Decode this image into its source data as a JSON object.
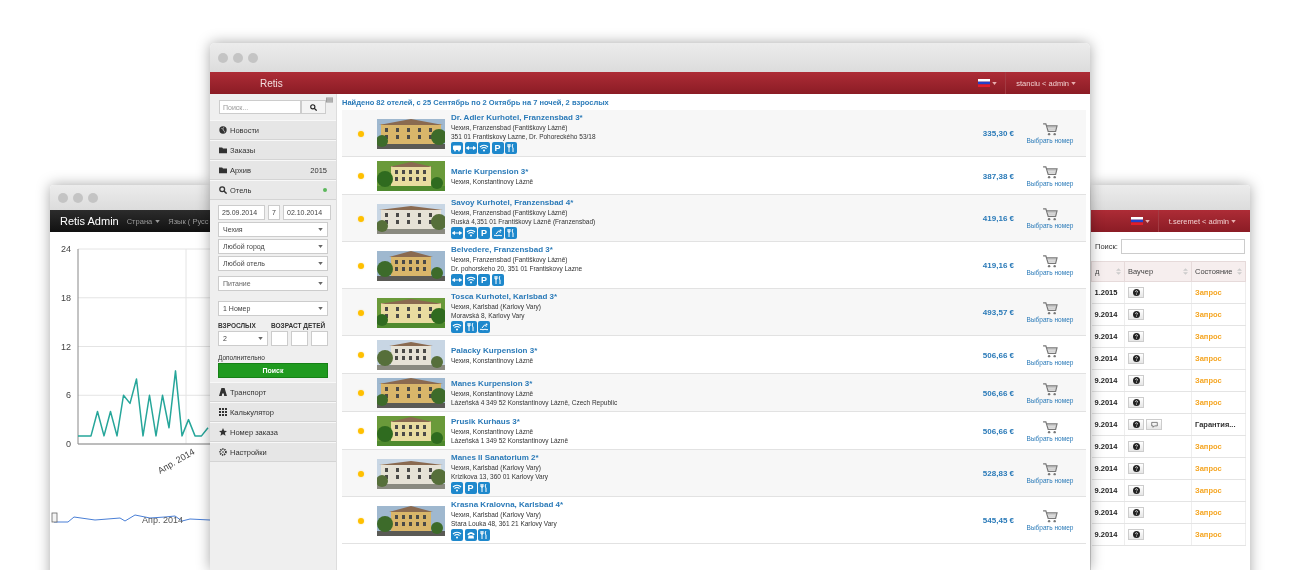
{
  "stats_window": {
    "brand": "Retis Admin",
    "menu": [
      {
        "label": "Страна",
        "dropdown": true
      },
      {
        "label": "Язык ( Русс",
        "dropdown": false
      }
    ],
    "chart_data": {
      "type": "line",
      "grid": true,
      "series": [
        {
          "color": "#26a69a",
          "values": [
            1,
            1,
            1,
            4,
            1,
            4,
            1,
            6,
            5,
            8,
            1,
            6,
            1,
            6,
            2,
            9,
            1,
            3,
            1,
            1,
            2
          ]
        }
      ],
      "ylim": [
        0,
        24
      ],
      "yticks": [
        0,
        6,
        12,
        18,
        24
      ]
    },
    "date_label": "Апр. 2014",
    "navigator": {
      "label": "Апр. 2014"
    }
  },
  "main_window": {
    "brand": "Retis",
    "user_menu": "stanciu < admin",
    "sidebar": {
      "search": {
        "placeholder": "Поиск..."
      },
      "menu": [
        {
          "label": "Новости",
          "kind": "globe",
          "expanded": false,
          "online": false
        },
        {
          "label": "Заказы",
          "kind": "folder",
          "expanded": false,
          "online": false
        },
        {
          "label": "Архив",
          "kind": "folder",
          "count": "2015",
          "expanded": false,
          "online": false
        },
        {
          "label": "Отель",
          "kind": "search",
          "expanded": true,
          "online": true
        },
        {
          "label": "Транспорт",
          "kind": "road",
          "expanded": false,
          "online": false
        },
        {
          "label": "Калькулятор",
          "kind": "grid",
          "expanded": false,
          "online": false
        },
        {
          "label": "Номер заказа",
          "kind": "star",
          "expanded": false,
          "online": false
        },
        {
          "label": "Настройки",
          "kind": "gear",
          "expanded": false,
          "online": false
        }
      ],
      "form": {
        "check_in": "25.09.2014",
        "nights": "7",
        "check_out": "02.10.2014",
        "selects": [
          "Чехия",
          "Любой город",
          "Любой отель"
        ],
        "meal": "Питание",
        "rooms": "1 Номер",
        "adults_label": "ВЗРОСЛЫХ",
        "children_label": "ВОЗРАСТ ДЕТЕЙ",
        "adults": "2",
        "extra_label": "Дополнительно",
        "search_button": "Поиск"
      }
    },
    "heading": "Найдено 82 отелей, с 25 Сентябрь по 2 Октябрь на 7 ночей, 2 взрослых",
    "hotels": [
      {
        "name": "Dr. Adler Kurhotel, Franzensbad 3*",
        "location": "Чехия, Franzensbad (Fantiškovy Lázně)",
        "address": "351 01 Frantiskovy Lazne, Dr. Pohoreckého 53/18",
        "amenities": [
          {
            "kind": "bus"
          },
          {
            "kind": "transfer"
          },
          {
            "kind": "wifi"
          },
          {
            "kind": "parking",
            "text": "P"
          },
          {
            "kind": "restaurant"
          }
        ],
        "price": "335,30 €",
        "action": "Выбрать номер",
        "color": "#ffc000"
      },
      {
        "name": "Marie Kurpension 3*",
        "location": "Чехия, Konstantinovy Lázně",
        "price": "387,38 €",
        "action": "Выбрать номер",
        "color": "#ffc000"
      },
      {
        "name": "Savoy Kurhotel, Franzensbad 4*",
        "location": "Чехия, Franzensbad (Fantiškovy Lázně)",
        "address": "Ruská 4,351 01 Františkovy Lázně (Franzensbad)",
        "amenities": [
          {
            "kind": "transfer"
          },
          {
            "kind": "wifi"
          },
          {
            "kind": "parking",
            "text": "P"
          },
          {
            "kind": "pool"
          },
          {
            "kind": "restaurant"
          }
        ],
        "price": "419,16 €",
        "action": "Выбрать номер",
        "color": "#ffc000"
      },
      {
        "name": "Belvedere, Franzensbad 3*",
        "location": "Чехия, Franzensbad (Fantiškovy Lázně)",
        "address": "Dr. pohorskeho 20, 351 01 Frantiskovy Lazne",
        "amenities": [
          {
            "kind": "transfer"
          },
          {
            "kind": "wifi"
          },
          {
            "kind": "parking",
            "text": "P"
          },
          {
            "kind": "restaurant"
          }
        ],
        "price": "419,16 €",
        "action": "Выбрать номер",
        "color": "#ffc000"
      },
      {
        "name": "Tosca Kurhotel, Karlsbad 3*",
        "location": "Чехия, Karlsbad (Karlovy Vary)",
        "address": "Moravská 8, Karlovy Vary",
        "amenities": [
          {
            "kind": "wifi"
          },
          {
            "kind": "restaurant"
          },
          {
            "kind": "pool"
          }
        ],
        "price": "493,57 €",
        "action": "Выбрать номер",
        "color": "#ffc000"
      },
      {
        "name": "Palacky Kurpension 3*",
        "location": "Чехия, Konstantinovy Lázně",
        "price": "506,66 €",
        "action": "Выбрать номер",
        "color": "#ffc000"
      },
      {
        "name": "Manes Kurpension 3*",
        "location": "Чехия, Konstantinovy Lázně",
        "address": "Lázeňská 4 349 52 Konstantinovy Lázně, Czech Republic",
        "price": "506,66 €",
        "action": "Выбрать номер",
        "color": "#ffc000"
      },
      {
        "name": "Prusik Kurhaus 3*",
        "location": "Чехия, Konstantinovy Lázně",
        "address": "Lázeňská 1 349 52 Konstantinovy Lázně",
        "price": "506,66 €",
        "action": "Выбрать номер",
        "color": "#ffc000"
      },
      {
        "name": "Manes II Sanatorium 2*",
        "location": "Чехия, Karlsbad (Karlovy Vary)",
        "address": "Krizikova 13, 360 01 Karlovy Vary",
        "amenities": [
          {
            "kind": "wifi"
          },
          {
            "kind": "parking",
            "text": "P"
          },
          {
            "kind": "restaurant"
          }
        ],
        "price": "528,83 €",
        "action": "Выбрать номер",
        "color": "#ffc000"
      },
      {
        "name": "Krasna Kralovna, Karlsbad 4*",
        "location": "Чехия, Karlsbad (Karlovy Vary)",
        "address": "Stara Louka 48, 361 21 Karlovy Vary",
        "amenities": [
          {
            "kind": "wifi"
          },
          {
            "kind": "phone"
          },
          {
            "kind": "restaurant"
          }
        ],
        "price": "545,45 €",
        "action": "Выбрать номер",
        "color": "#ffc000"
      }
    ]
  },
  "orders_window": {
    "user_menu": "t.seremet < admin",
    "search_label": "Поиск:",
    "columns": [
      "д",
      "Ваучер",
      "Состояние"
    ],
    "rows": [
      {
        "date": "1.2015",
        "vouchers": [
          {
            "kind": "info"
          }
        ],
        "status": "Запрос",
        "color": "#f5a623"
      },
      {
        "date": "9.2014",
        "vouchers": [
          {
            "kind": "info"
          }
        ],
        "status": "Запрос",
        "color": "#f5a623"
      },
      {
        "date": "9.2014",
        "vouchers": [
          {
            "kind": "info"
          }
        ],
        "status": "Запрос",
        "color": "#f5a623"
      },
      {
        "date": "9.2014",
        "vouchers": [
          {
            "kind": "info"
          }
        ],
        "status": "Запрос",
        "color": "#f5a623"
      },
      {
        "date": "9.2014",
        "vouchers": [
          {
            "kind": "info"
          }
        ],
        "status": "Запрос",
        "color": "#f5a623"
      },
      {
        "date": "9.2014",
        "vouchers": [
          {
            "kind": "info"
          }
        ],
        "status": "Запрос",
        "color": "#f5a623"
      },
      {
        "date": "9.2014",
        "vouchers": [
          {
            "kind": "info"
          },
          {
            "kind": "comment"
          }
        ],
        "status": "Гарантия...",
        "color": "#333333"
      },
      {
        "date": "9.2014",
        "vouchers": [
          {
            "kind": "info"
          }
        ],
        "status": "Запрос",
        "color": "#f5a623"
      },
      {
        "date": "9.2014",
        "vouchers": [
          {
            "kind": "info"
          }
        ],
        "status": "Запрос",
        "color": "#f5a623"
      },
      {
        "date": "9.2014",
        "vouchers": [
          {
            "kind": "info"
          }
        ],
        "status": "Запрос",
        "color": "#f5a623"
      },
      {
        "date": "9.2014",
        "vouchers": [
          {
            "kind": "info"
          }
        ],
        "status": "Запрос",
        "color": "#f5a623"
      },
      {
        "date": "9.2014",
        "vouchers": [
          {
            "kind": "info"
          }
        ],
        "status": "Запрос",
        "color": "#f5a623"
      }
    ]
  }
}
